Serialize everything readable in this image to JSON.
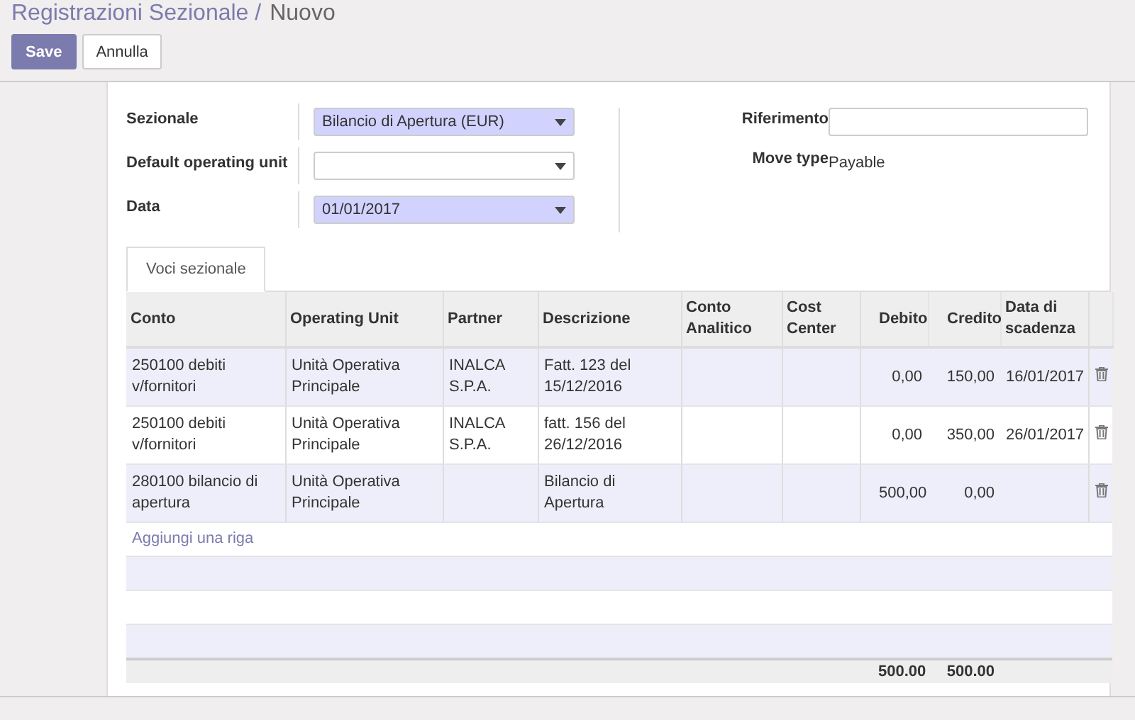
{
  "breadcrumb": {
    "parent": "Registrazioni Sezionale /",
    "current": "Nuovo"
  },
  "buttons": [
    {
      "label": "Save",
      "kind": "primary"
    },
    {
      "label": "Annulla",
      "kind": "secondary"
    }
  ],
  "form": {
    "left": [
      {
        "label": "Sezionale",
        "value": "Bilancio di Apertura (EUR)",
        "highlighted": true
      },
      {
        "label": "Default operating unit",
        "highlighted": false
      },
      {
        "label": "Data",
        "value": "01/01/2017",
        "highlighted": true
      }
    ],
    "right": [
      {
        "label": "Riferimento",
        "kind": "input"
      },
      {
        "label": "Move type",
        "kind": "text",
        "value": "Payable"
      }
    ]
  },
  "tabs": [
    {
      "label": "Voci sezionale",
      "selected": true
    }
  ],
  "table": {
    "columns": [
      "Conto",
      "Operating Unit",
      "Partner",
      "Descrizione",
      "Conto Analitico",
      "Cost Center",
      "Debito",
      "Credito",
      "Data di scadenza"
    ],
    "rows": [
      {
        "cells": [
          "250100 debiti v/fornitori",
          "Unità Operativa Principale",
          "INALCA S.P.A.",
          "Fatt. 123 del 15/12/2016",
          "",
          "",
          "0,00",
          "150,00",
          "16/01/2017"
        ]
      },
      {
        "cells": [
          "250100 debiti v/fornitori",
          "Unità Operativa Principale",
          "INALCA S.P.A.",
          "fatt. 156 del 26/12/2016",
          "",
          "",
          "0,00",
          "350,00",
          "26/01/2017"
        ]
      },
      {
        "cells": [
          "280100 bilancio di apertura",
          "Unità Operativa Principale",
          "",
          "Bilancio di Apertura",
          "",
          "",
          "500,00",
          "0,00",
          ""
        ]
      }
    ],
    "add_line": "Aggiungi una riga",
    "totals": {
      "debito": "500.00",
      "credito": "500.00"
    }
  }
}
